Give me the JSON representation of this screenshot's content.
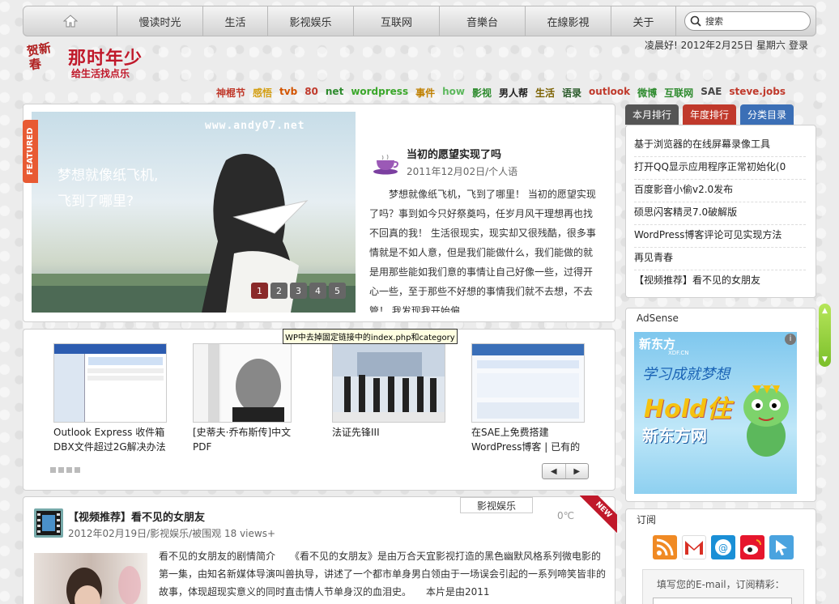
{
  "nav": {
    "items": [
      "慢读时光",
      "生活",
      "影视娱乐",
      "互联网",
      "音樂台",
      "在線影視",
      "关于"
    ],
    "search_placeholder": "搜索"
  },
  "header": {
    "greeting": "凌晨好! 2012年2月25日 星期六",
    "login": "登录",
    "logo_text": "那时年少",
    "logo_sub": "给生活找点乐",
    "logo_stamp": "贺新春"
  },
  "tags": [
    {
      "label": "神棍节",
      "color": "#c0392b"
    },
    {
      "label": "感悟",
      "color": "#d4a017"
    },
    {
      "label": "tvb",
      "color": "#d35400"
    },
    {
      "label": "80",
      "color": "#c0392b"
    },
    {
      "label": "net",
      "color": "#2e8b2e"
    },
    {
      "label": "wordpress",
      "color": "#3aa72a"
    },
    {
      "label": "事件",
      "color": "#c08000"
    },
    {
      "label": "how",
      "color": "#5cb85c"
    },
    {
      "label": "影视",
      "color": "#2e8b2e"
    },
    {
      "label": "男人帮",
      "color": "#222222"
    },
    {
      "label": "生活",
      "color": "#7a6000"
    },
    {
      "label": "语录",
      "color": "#2b5b2b"
    },
    {
      "label": "outlook",
      "color": "#c0392b"
    },
    {
      "label": "微博",
      "color": "#2e8b2e"
    },
    {
      "label": "互联网",
      "color": "#2e8b2e"
    },
    {
      "label": "SAE",
      "color": "#444444"
    },
    {
      "label": "steve.jobs",
      "color": "#c0392b"
    }
  ],
  "featured": {
    "tab": "FEATURED",
    "image_url_text": "www.andy07.net",
    "image_caption_1": "梦想就像纸飞机,",
    "image_caption_2": "飞到了哪里?",
    "dots": [
      "1",
      "2",
      "3",
      "4",
      "5"
    ],
    "active_dot": 0,
    "title": "当初的愿望实现了吗",
    "meta": "2011年12月02日/个人语",
    "text": "梦想就像纸飞机，飞到了哪里！ 当初的愿望实现了吗？事到如今只好祭奠吗，任岁月风干理想再也找不回真的我！ 生活很现实，现实却又很残酷，很多事情就是不如人意，但是我们能做什么，我们能做的就是用那些能如我们意的事情让自己好像一些，过得开心一些，至于那些不好想的事情我们就不去想，不去管！ 我发现我开始偏"
  },
  "carousel": {
    "tooltip": "WP中去掉固定链接中的index.php和category",
    "items": [
      {
        "caption": "Outlook Express 收件箱DBX文件超过2G解决办法"
      },
      {
        "caption": "[史蒂夫·乔布斯传]中文PDF"
      },
      {
        "caption": "法证先锋III"
      },
      {
        "caption": "在SAE上免费搭建WordPress博客 | 已有的"
      }
    ],
    "prev": "◀",
    "next": "▶"
  },
  "post": {
    "title": "【视频推荐】看不见的女朋友",
    "meta": "2012年02月19日/影视娱乐/被围观 18 views+",
    "category": "影视娱乐",
    "temp": "0℃",
    "ribbon": "NEW",
    "text": "看不见的女朋友的剧情简介　　《看不见的女朋友》是由万合天宜影视打造的黑色幽默风格系列微电影的第一集，由知名新媒体导演叫兽执导，讲述了一个都市单身男白领由于一场误会引起的一系列啼笑皆非的故事，体现超现实意义的同时直击情人节单身汉的血泪史。　　本片是由2011"
  },
  "sidebar": {
    "tabs": [
      {
        "label": "本月排行",
        "color": "#555555"
      },
      {
        "label": "年度排行",
        "color": "#c0392b"
      },
      {
        "label": "分类目录",
        "color": "#3b6fb6"
      }
    ],
    "rank": [
      "基于浏览器的在线屏幕录像工具",
      "打开QQ显示应用程序正常初始化(0",
      "百度影音小偷v2.0发布",
      "硕思闪客精灵7.0破解版",
      "WordPress博客评论可见实现方法",
      "再见青春",
      "【视频推荐】看不见的女朋友"
    ],
    "adsense_title": "AdSense",
    "ad": {
      "brand": "新东方",
      "brand_sub": "XDF.CN",
      "slogan": "学习成就梦想",
      "hold": "Hold住",
      "hold2": "新东方网"
    },
    "subscribe_title": "订阅",
    "subscribe_label": "填写您的E-mail，订阅精彩：",
    "subscribe_icons": [
      "rss-icon",
      "gmail-icon",
      "qq-mail-icon",
      "weibo-icon",
      "xianguo-icon"
    ]
  }
}
